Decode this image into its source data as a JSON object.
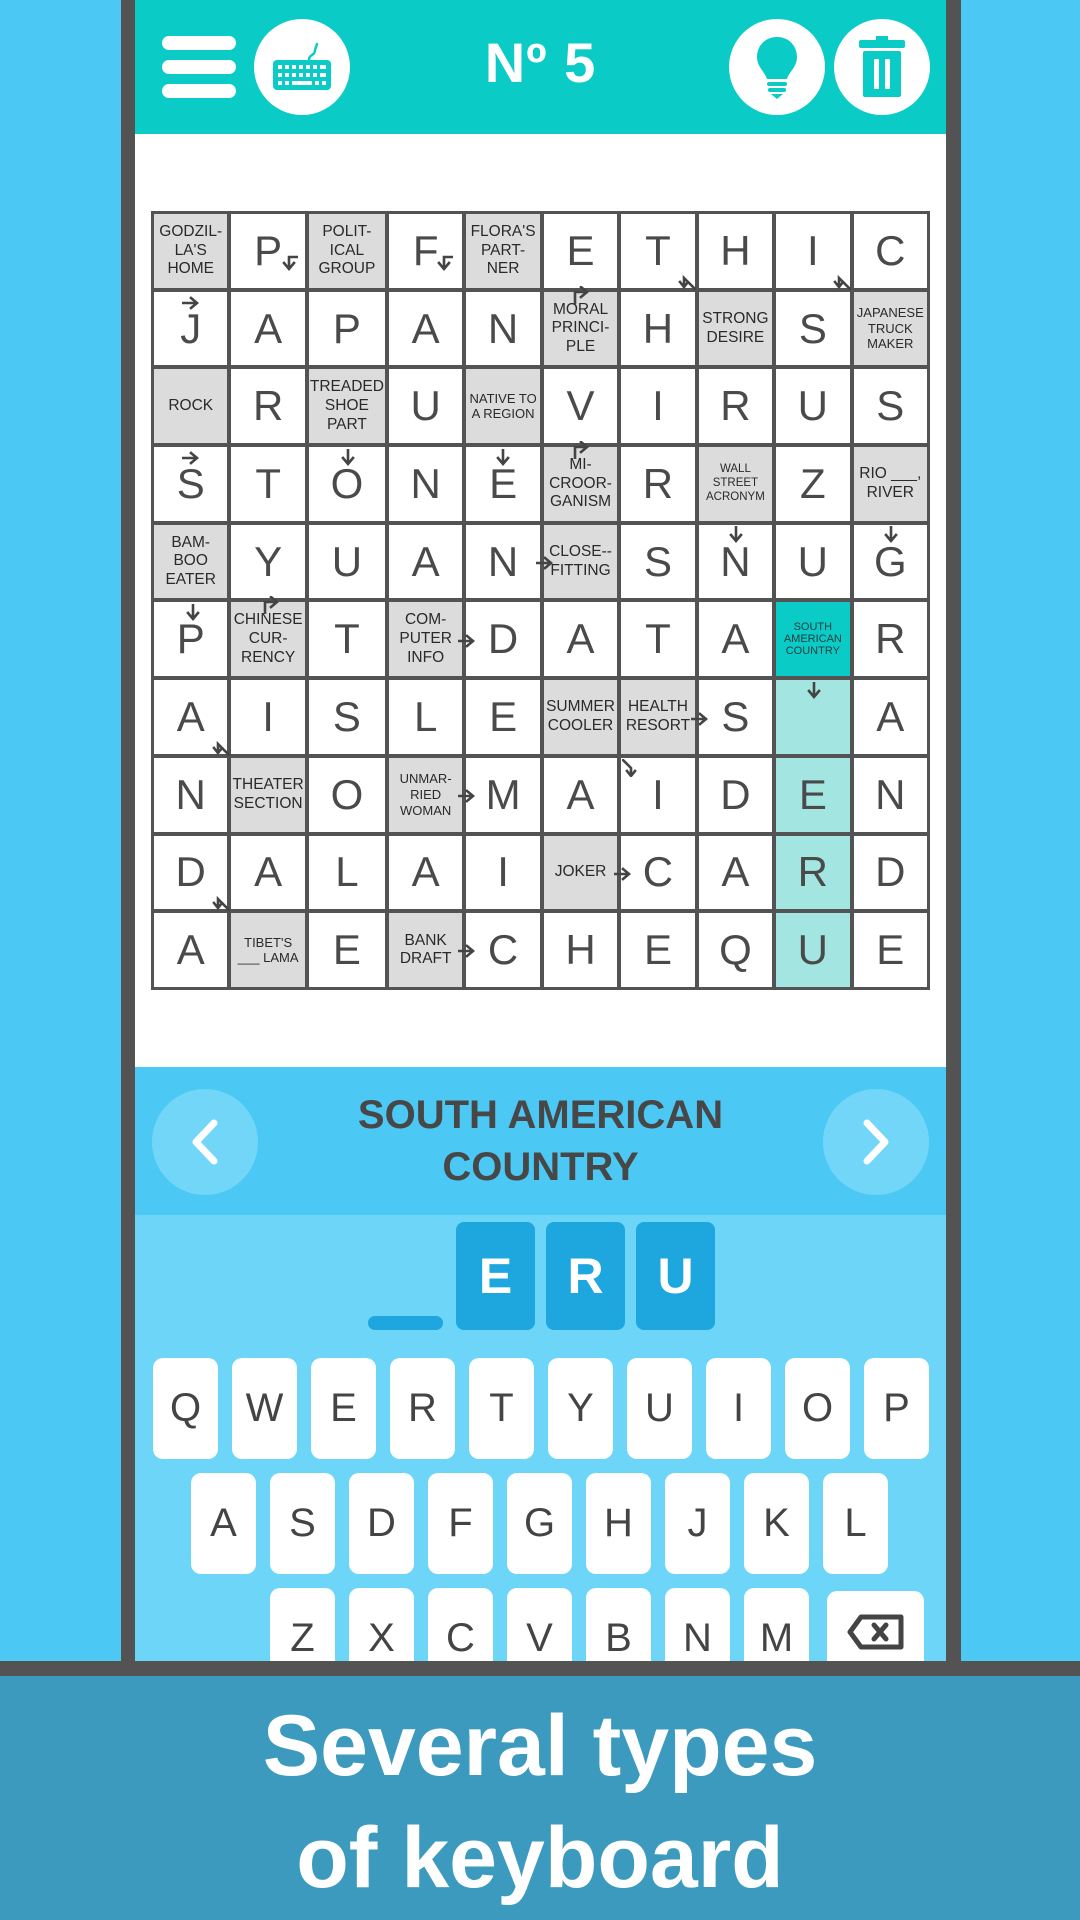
{
  "header": {
    "title": "Nº 5",
    "icons": {
      "menu": "hamburger-menu-icon",
      "keyboard": "keyboard-icon",
      "hint": "lightbulb-icon",
      "trash": "trash-icon"
    }
  },
  "colors": {
    "header_teal": "#0bcbc6",
    "active_cell": "#0bcbc6",
    "highlight_cell": "#a3e6e1",
    "clue_cell": "#dcdcdc",
    "clue_bar": "#4cc8f4",
    "keyboard_bg": "#6dd5f8",
    "answer_slot": "#1ea6df",
    "banner": "#3b9abd",
    "frame": "#535353"
  },
  "grid": {
    "rows": [
      [
        {
          "t": "clue",
          "v": "GODZIL-\nLA'S\nHOME"
        },
        {
          "t": "l",
          "v": "P"
        },
        {
          "t": "clue",
          "v": "POLIT-\nICAL\nGROUP"
        },
        {
          "t": "l",
          "v": "F"
        },
        {
          "t": "clue",
          "v": "FLORA'S\nPART-\nNER"
        },
        {
          "t": "l",
          "v": "E"
        },
        {
          "t": "l",
          "v": "T"
        },
        {
          "t": "l",
          "v": "H"
        },
        {
          "t": "l",
          "v": "I"
        },
        {
          "t": "l",
          "v": "C"
        }
      ],
      [
        {
          "t": "l",
          "v": "J"
        },
        {
          "t": "l",
          "v": "A"
        },
        {
          "t": "l",
          "v": "P"
        },
        {
          "t": "l",
          "v": "A"
        },
        {
          "t": "l",
          "v": "N"
        },
        {
          "t": "clue",
          "v": "MORAL\nPRINCI-\nPLE"
        },
        {
          "t": "l",
          "v": "H"
        },
        {
          "t": "clue",
          "v": "STRONG\nDESIRE"
        },
        {
          "t": "l",
          "v": "S"
        },
        {
          "t": "clue",
          "v": "JAPANESE\nTRUCK\nMAKER",
          "s": "small"
        }
      ],
      [
        {
          "t": "clue",
          "v": "ROCK"
        },
        {
          "t": "l",
          "v": "R"
        },
        {
          "t": "clue",
          "v": "TREADED\nSHOE\nPART"
        },
        {
          "t": "l",
          "v": "U"
        },
        {
          "t": "clue",
          "v": "NATIVE TO\nA REGION",
          "s": "small"
        },
        {
          "t": "l",
          "v": "V"
        },
        {
          "t": "l",
          "v": "I"
        },
        {
          "t": "l",
          "v": "R"
        },
        {
          "t": "l",
          "v": "U"
        },
        {
          "t": "l",
          "v": "S"
        }
      ],
      [
        {
          "t": "l",
          "v": "S"
        },
        {
          "t": "l",
          "v": "T"
        },
        {
          "t": "l",
          "v": "O"
        },
        {
          "t": "l",
          "v": "N"
        },
        {
          "t": "l",
          "v": "E"
        },
        {
          "t": "clue",
          "v": "MI-\nCROOR-\nGANISM"
        },
        {
          "t": "l",
          "v": "R"
        },
        {
          "t": "clue",
          "v": "WALL STREET\nACRONYM",
          "s": "xsmall"
        },
        {
          "t": "l",
          "v": "Z"
        },
        {
          "t": "clue",
          "v": "RIO ___,\nRIVER"
        }
      ],
      [
        {
          "t": "clue",
          "v": "BAM-\nBOO\nEATER"
        },
        {
          "t": "l",
          "v": "Y"
        },
        {
          "t": "l",
          "v": "U"
        },
        {
          "t": "l",
          "v": "A"
        },
        {
          "t": "l",
          "v": "N"
        },
        {
          "t": "clue",
          "v": "CLOSE--\nFITTING"
        },
        {
          "t": "l",
          "v": "S"
        },
        {
          "t": "l",
          "v": "N"
        },
        {
          "t": "l",
          "v": "U"
        },
        {
          "t": "l",
          "v": "G"
        }
      ],
      [
        {
          "t": "l",
          "v": "P"
        },
        {
          "t": "clue",
          "v": "CHINESE\nCUR-\nRENCY"
        },
        {
          "t": "l",
          "v": "T"
        },
        {
          "t": "clue",
          "v": "COM-\nPUTER\nINFO"
        },
        {
          "t": "l",
          "v": "D"
        },
        {
          "t": "l",
          "v": "A"
        },
        {
          "t": "l",
          "v": "T"
        },
        {
          "t": "l",
          "v": "A"
        },
        {
          "t": "active",
          "v": "SOUTH\nAMERICAN\nCOUNTRY"
        },
        {
          "t": "l",
          "v": "R"
        }
      ],
      [
        {
          "t": "l",
          "v": "A"
        },
        {
          "t": "l",
          "v": "I"
        },
        {
          "t": "l",
          "v": "S"
        },
        {
          "t": "l",
          "v": "L"
        },
        {
          "t": "l",
          "v": "E"
        },
        {
          "t": "clue",
          "v": "SUMMER\nCOOLER"
        },
        {
          "t": "clue",
          "v": "HEALTH\nRESORT"
        },
        {
          "t": "l",
          "v": "S"
        },
        {
          "t": "hl",
          "v": ""
        },
        {
          "t": "l",
          "v": "A"
        }
      ],
      [
        {
          "t": "l",
          "v": "N"
        },
        {
          "t": "clue",
          "v": "THEATER\nSECTION"
        },
        {
          "t": "l",
          "v": "O"
        },
        {
          "t": "clue",
          "v": "UNMAR-\nRIED\nWOMAN",
          "s": "small"
        },
        {
          "t": "l",
          "v": "M"
        },
        {
          "t": "l",
          "v": "A"
        },
        {
          "t": "l",
          "v": "I"
        },
        {
          "t": "l",
          "v": "D"
        },
        {
          "t": "hl",
          "v": "E"
        },
        {
          "t": "l",
          "v": "N"
        }
      ],
      [
        {
          "t": "l",
          "v": "D"
        },
        {
          "t": "l",
          "v": "A"
        },
        {
          "t": "l",
          "v": "L"
        },
        {
          "t": "l",
          "v": "A"
        },
        {
          "t": "l",
          "v": "I"
        },
        {
          "t": "clue",
          "v": "JOKER"
        },
        {
          "t": "l",
          "v": "C"
        },
        {
          "t": "l",
          "v": "A"
        },
        {
          "t": "hl",
          "v": "R"
        },
        {
          "t": "l",
          "v": "D"
        }
      ],
      [
        {
          "t": "l",
          "v": "A"
        },
        {
          "t": "clue",
          "v": "TIBET'S\n___ LAMA",
          "s": "small"
        },
        {
          "t": "l",
          "v": "E"
        },
        {
          "t": "clue",
          "v": "BANK\nDRAFT"
        },
        {
          "t": "l",
          "v": "C"
        },
        {
          "t": "l",
          "v": "H"
        },
        {
          "t": "l",
          "v": "E"
        },
        {
          "t": "l",
          "v": "Q"
        },
        {
          "t": "hl",
          "v": "U"
        },
        {
          "t": "l",
          "v": "E"
        }
      ]
    ]
  },
  "clue_bar": {
    "text": "SOUTH AMERICAN COUNTRY",
    "prev_icon": "chevron-left-icon",
    "next_icon": "chevron-right-icon"
  },
  "answer": {
    "slots": [
      "",
      "E",
      "R",
      "U"
    ]
  },
  "keyboard": {
    "rows": [
      [
        "Q",
        "W",
        "E",
        "R",
        "T",
        "Y",
        "U",
        "I",
        "O",
        "P"
      ],
      [
        "A",
        "S",
        "D",
        "F",
        "G",
        "H",
        "J",
        "K",
        "L"
      ],
      [
        "Z",
        "X",
        "C",
        "V",
        "B",
        "N",
        "M"
      ]
    ],
    "backspace_icon": "backspace-icon"
  },
  "banner": {
    "line1": "Several types",
    "line2": "of keyboard"
  }
}
